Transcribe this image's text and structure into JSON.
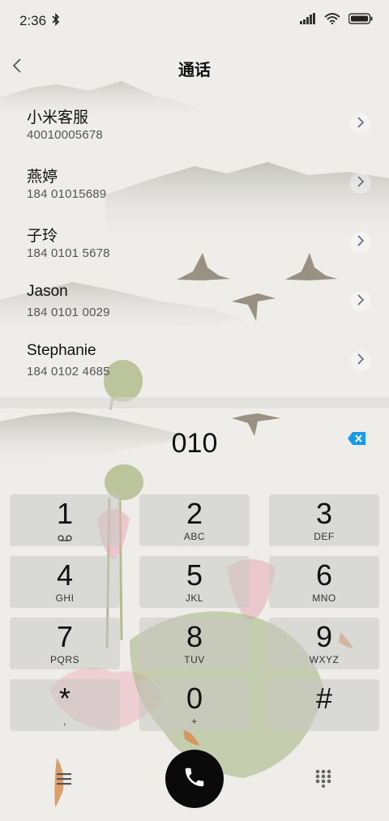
{
  "status": {
    "time": "2:36"
  },
  "header": {
    "title": "通话"
  },
  "contacts": [
    {
      "name": "小米客服",
      "number": "40010005678"
    },
    {
      "name": "燕婷",
      "number": "184 01015689"
    },
    {
      "name": "子玲",
      "number": "184 0101 5678"
    },
    {
      "name": "Jason",
      "number": "184 0101 0029"
    },
    {
      "name": "Stephanie",
      "number": "184 0102 4685"
    }
  ],
  "dial": {
    "input": "010"
  },
  "keys": [
    {
      "digit": "1",
      "letters": ""
    },
    {
      "digit": "2",
      "letters": "ABC"
    },
    {
      "digit": "3",
      "letters": "DEF"
    },
    {
      "digit": "4",
      "letters": "GHI"
    },
    {
      "digit": "5",
      "letters": "JKL"
    },
    {
      "digit": "6",
      "letters": "MNO"
    },
    {
      "digit": "7",
      "letters": "PQRS"
    },
    {
      "digit": "8",
      "letters": "TUV"
    },
    {
      "digit": "9",
      "letters": "WXYZ"
    },
    {
      "digit": "*",
      "letters": ","
    },
    {
      "digit": "0",
      "letters": "+"
    },
    {
      "digit": "#",
      "letters": ""
    }
  ],
  "colors": {
    "accent": "#1a9be8",
    "call": "#0a0a0a"
  }
}
